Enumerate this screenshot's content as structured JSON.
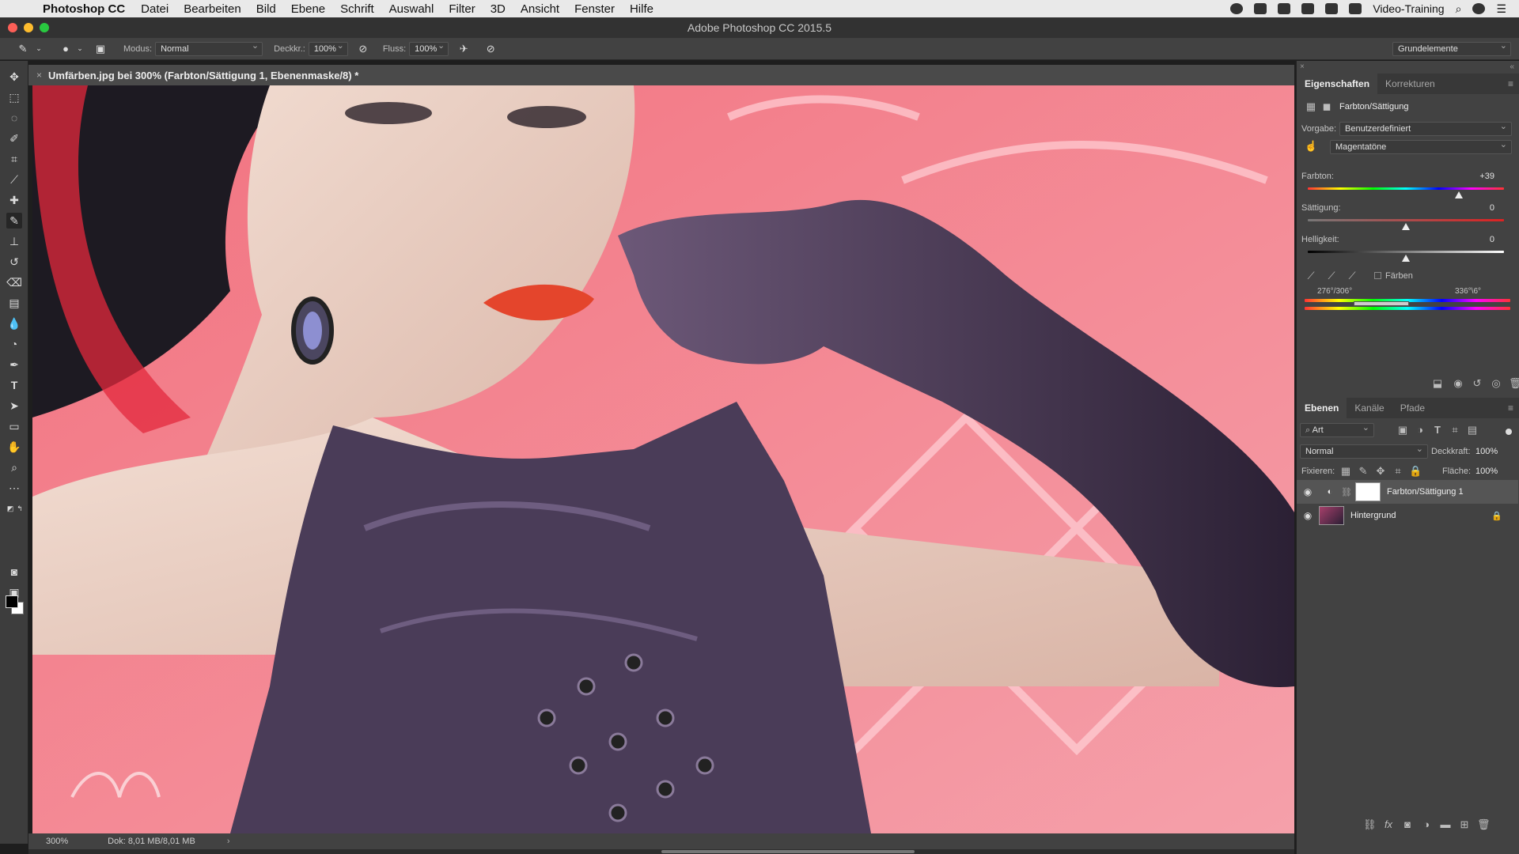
{
  "menubar": {
    "app_name": "Photoshop CC",
    "items": [
      "Datei",
      "Bearbeiten",
      "Bild",
      "Ebene",
      "Schrift",
      "Auswahl",
      "Filter",
      "3D",
      "Ansicht",
      "Fenster",
      "Hilfe"
    ],
    "right_label": "Video-Training"
  },
  "window": {
    "title": "Adobe Photoshop CC 2015.5"
  },
  "options": {
    "mode_label": "Modus:",
    "mode_value": "Normal",
    "opacity_label": "Deckkr.:",
    "opacity_value": "100%",
    "flow_label": "Fluss:",
    "flow_value": "100%",
    "workspace": "Grundelemente"
  },
  "document": {
    "tab_title": "Umfärben.jpg bei 300% (Farbton/Sättigung 1, Ebenenmaske/8) *",
    "zoom": "300%",
    "doc_info": "Dok: 8,01 MB/8,01 MB"
  },
  "properties": {
    "tabs": [
      "Eigenschaften",
      "Korrekturen"
    ],
    "adjustment_title": "Farbton/Sättigung",
    "preset_label": "Vorgabe:",
    "preset_value": "Benutzerdefiniert",
    "channel_value": "Magentatöne",
    "hue_label": "Farbton:",
    "hue_value": "+39",
    "hue_fraction": 0.77,
    "saturation_label": "Sättigung:",
    "saturation_value": "0",
    "saturation_fraction": 0.5,
    "lightness_label": "Helligkeit:",
    "lightness_value": "0",
    "lightness_fraction": 0.5,
    "colorize_label": "Färben",
    "range_left": "276°/306°",
    "range_right": "336°\\6°"
  },
  "layers": {
    "tabs": [
      "Ebenen",
      "Kanäle",
      "Pfade"
    ],
    "filter_value": "Art",
    "blend_value": "Normal",
    "opacity_label": "Deckkraft:",
    "opacity_value": "100%",
    "lock_label": "Fixieren:",
    "fill_label": "Fläche:",
    "fill_value": "100%",
    "items": [
      {
        "name": "Farbton/Sättigung 1"
      },
      {
        "name": "Hintergrund"
      }
    ]
  },
  "colors": {
    "accent_background": "#f06b7a",
    "glove": "#3a2c44",
    "corset": "#4a3c58"
  }
}
